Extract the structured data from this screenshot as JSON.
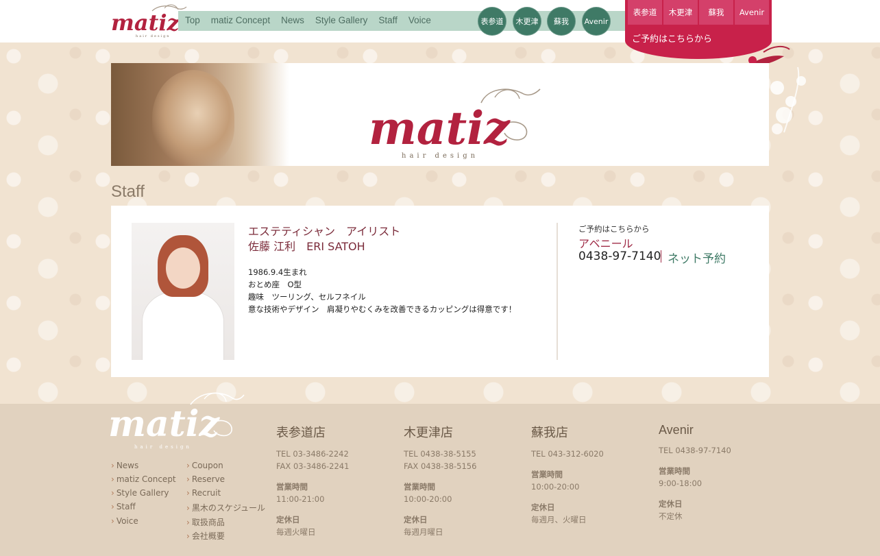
{
  "header": {
    "nav": [
      "Top",
      "matiz Concept",
      "News",
      "Style Gallery",
      "Staff",
      "Voice"
    ],
    "shop_circles": [
      "表参道",
      "木更津",
      "蘇我",
      "Avenir"
    ],
    "reserve_tabs": [
      "表参道",
      "木更津",
      "蘇我",
      "Avenir"
    ],
    "reserve_label": "ご予約はこちらから"
  },
  "page": {
    "heading": "Staff"
  },
  "staff": {
    "role": "エステティシャン　アイリスト",
    "name": "佐藤 江利　ERI SATOH",
    "details": [
      "1986.9.4生まれ",
      "おとめ座　O型",
      "趣味　ツーリング、セルフネイル",
      "意な技術やデザイン　肩凝りやむくみを改善できるカッピングは得意です！"
    ]
  },
  "reservation": {
    "caption": "ご予約はこちらから",
    "shop": "アベニール",
    "tel": "0438-97-7140",
    "net_label": "ネット予約"
  },
  "footer": {
    "links_left": [
      "News",
      "matiz Concept",
      "Style Gallery",
      "Staff",
      "Voice"
    ],
    "links_right": [
      "Coupon",
      "Reserve",
      "Recruit",
      "黒木のスケジュール",
      "取扱商品",
      "会社概要"
    ],
    "shops": [
      {
        "name": "表参道店",
        "tel": "TEL 03-3486-2242",
        "fax": "FAX 03-3486-2241",
        "hours_label": "営業時間",
        "hours": "11:00-21:00",
        "holiday_label": "定休日",
        "holiday": "毎週火曜日"
      },
      {
        "name": "木更津店",
        "tel": "TEL 0438-38-5155",
        "fax": "FAX 0438-38-5156",
        "hours_label": "営業時間",
        "hours": "10:00-20:00",
        "holiday_label": "定休日",
        "holiday": "毎週月曜日"
      },
      {
        "name": "蘇我店",
        "tel": "TEL 043-312-6020",
        "fax": "",
        "hours_label": "営業時間",
        "hours": "10:00-20:00",
        "holiday_label": "定休日",
        "holiday": "毎週月、火曜日"
      },
      {
        "name": "Avenir",
        "tel": "TEL 0438-97-7140",
        "fax": "",
        "hours_label": "営業時間",
        "hours": "9:00-18:00",
        "holiday_label": "定休日",
        "holiday": "不定休"
      }
    ]
  },
  "brand": {
    "logo_text": "matiz",
    "logo_sub": "hair design",
    "colors": {
      "accent_red": "#c8214a",
      "nav_green": "#3f7a66",
      "nav_bar": "#b9d6c8",
      "footer_bg": "#e1d2bf"
    }
  }
}
